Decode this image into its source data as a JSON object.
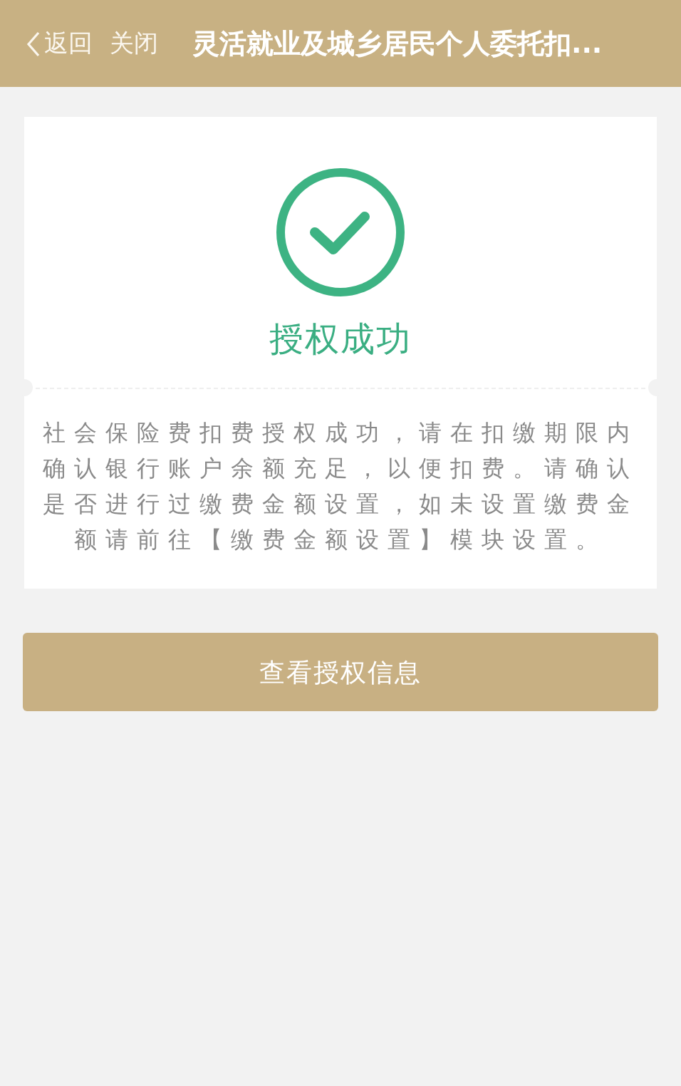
{
  "nav_bar": {
    "back": "返回",
    "close": "关闭",
    "title": "灵活就业及城乡居民个人委托扣..."
  },
  "result": {
    "kind": "success",
    "title": "授权成功",
    "message": "社会保险费扣费授权成功，请在扣缴期限内确认银行账户余额充足，以便扣费。请确认是否进行过缴费金额设置，如未设置缴费金额请前往【缴费金额设置】模块设置。"
  },
  "buttons": [
    "查看授权信息"
  ]
}
